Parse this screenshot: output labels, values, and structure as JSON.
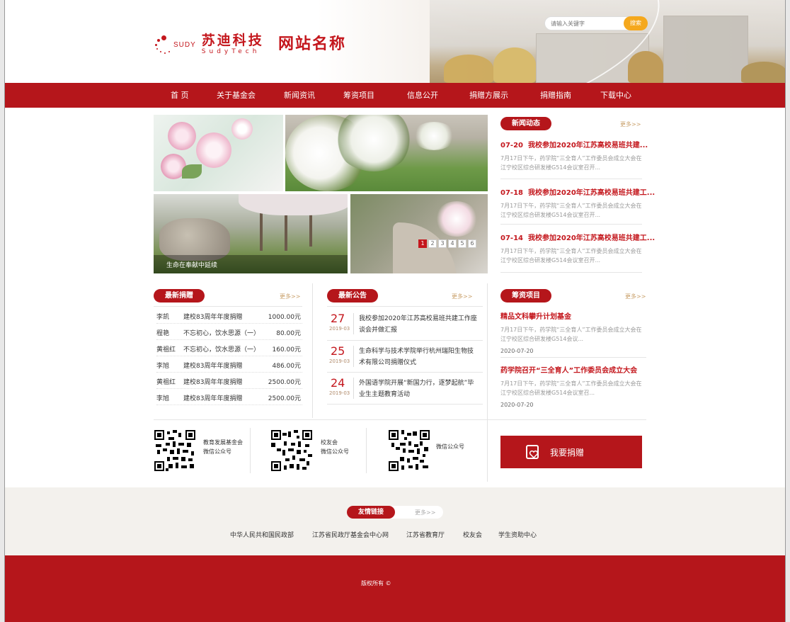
{
  "header": {
    "logo_sudy": "SUDY",
    "logo_cn": "苏迪科技",
    "logo_en": "SudyTech",
    "site_name": "网站名称",
    "search_placeholder": "请输入关键字",
    "search_button": "搜索"
  },
  "nav": [
    "首 页",
    "关于基金会",
    "新闻资讯",
    "筹资项目",
    "信息公开",
    "捐赠方展示",
    "捐赠指南",
    "下载中心"
  ],
  "banner": {
    "caption": "生命在奉献中延续",
    "pages": [
      "1",
      "2",
      "3",
      "4",
      "5",
      "6"
    ],
    "active_page": 1
  },
  "news": {
    "title": "新闻动态",
    "more": "更多>>",
    "items": [
      {
        "date": "07-20",
        "title": "我校参加2020年江苏高校易班共建...",
        "desc": "7月17日下午，药学院“三全育人”工作委员会成立大会在江宁校区综合研发楼G514会议室召开..."
      },
      {
        "date": "07-18",
        "title": "我校参加2020年江苏高校易班共建工...",
        "desc": "7月17日下午，药学院“三全育人”工作委员会成立大会在江宁校区综合研发楼G514会议室召开..."
      },
      {
        "date": "07-14",
        "title": "我校参加2020年江苏高校易班共建工...",
        "desc": "7月17日下午，药学院“三全育人”工作委员会成立大会在江宁校区综合研发楼G514会议室召开..."
      }
    ]
  },
  "donations": {
    "title": "最新捐赠",
    "more": "更多>>",
    "rows": [
      {
        "name": "李凯",
        "item": "建校83周年年度捐赠",
        "amount": "1000.00元"
      },
      {
        "name": "程艳",
        "item": "不忘初心，饮水思源（一）",
        "amount": "80.00元"
      },
      {
        "name": "黄祖红",
        "item": "不忘初心，饮水思源（一）",
        "amount": "160.00元"
      },
      {
        "name": "李旭",
        "item": "建校83周年年度捐赠",
        "amount": "486.00元"
      },
      {
        "name": "黄祖红",
        "item": "建校83周年年度捐赠",
        "amount": "2500.00元"
      },
      {
        "name": "李旭",
        "item": "建校83周年年度捐赠",
        "amount": "2500.00元"
      }
    ]
  },
  "notices": {
    "title": "最新公告",
    "more": "更多>>",
    "items": [
      {
        "day": "27",
        "ym": "2019-03",
        "text": "我校参加2020年江苏高校易班共建工作座谈会并做汇报"
      },
      {
        "day": "25",
        "ym": "2019-03",
        "text": "生命科学与技术学院举行杭州瑞阳生物技术有限公司捐赠仪式"
      },
      {
        "day": "24",
        "ym": "2019-03",
        "text": "外国语学院开展“新国力行，逐梦起航”毕业生主题教育活动"
      }
    ]
  },
  "projects": {
    "title": "筹资项目",
    "more": "更多>>",
    "items": [
      {
        "title": "精品文科攀升计划基金",
        "desc": "7月17日下午，药学院“三全育人”工作委员会成立大会在江宁校区综合研发楼G514会议...",
        "date": "2020-07-20"
      },
      {
        "title": "药学院召开“三全育人”工作委员会成立大会",
        "desc": "7月17日下午，药学院“三全育人”工作委员会成立大会在江宁校区综合研发楼G514会议室召...",
        "date": "2020-07-20"
      }
    ]
  },
  "qr": [
    {
      "line1": "教育发展基金会",
      "line2": "微信公众号"
    },
    {
      "line1": "校友会",
      "line2": "微信公众号"
    },
    {
      "line1": "微信公众号",
      "line2": ""
    }
  ],
  "donate_button": "我要捐赠",
  "friend_links": {
    "title": "友情链接",
    "more": "更多>>",
    "items": [
      "中华人民共和国民政部",
      "江苏省民政厅基金会中心网",
      "江苏省教育厅",
      "校友会",
      "学生资助中心"
    ]
  },
  "copyright": "版权所有 ©",
  "colors": {
    "brand_red": "#b5161b",
    "accent_orange": "#f5a81d",
    "text_red": "#c4171d"
  }
}
